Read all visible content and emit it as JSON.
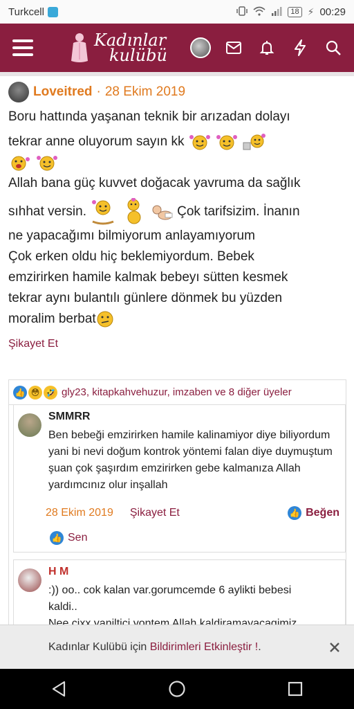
{
  "status_bar": {
    "carrier": "Turkcell",
    "battery": "18",
    "time": "00:29"
  },
  "header": {
    "logo_line1": "Kadınlar",
    "logo_line2": "kulübü",
    "brand_color": "#8a1e3f",
    "icons": [
      "avatar",
      "mail-icon",
      "bell-icon",
      "bolt-icon",
      "search-icon"
    ]
  },
  "post": {
    "author": "Loveitred",
    "separator": "·",
    "date": "28 Ekim 2019",
    "line1": "Boru hattında yaşanan teknik bir arızadan dolayı",
    "line2": "tekrar anne oluyorum sayın kk",
    "line3": "Allah bana güç kuvvet doğacak yavruma da sağlık",
    "line4a": "sıhhat versin.",
    "line4b": "Çok tarifsizim. İnanın",
    "line5": "ne yapacağımı bilmiyorum anlayamıyorum",
    "line6": "Çok erken oldu hiç beklemiyordum. Bebek",
    "line7": "emzirirken hamile kalmak bebeyı sütten kesmek",
    "line8": "tekrar aynı bulantılı günlere dönmek bu yüzden",
    "line9": "moralim berbat",
    "report": "Şikayet Et"
  },
  "reactions": {
    "text": "gly23, kitapkahvehuzur, imzaben ve 8 diğer üyeler"
  },
  "comments": [
    {
      "name": "SMMRR",
      "text": "Ben bebeği emzirirken hamile kalinamiyor diye biliyordum yani bi nevi doğum kontrok yöntemi falan diye duymuştum şuan çok şaşırdım emzirirken gebe kalmanıza Allah yardımcınız olur inşallah",
      "date": "28 Ekim 2019",
      "report": "Şikayet Et",
      "like": "Beğen",
      "reactor": "Sen"
    },
    {
      "name": "H M",
      "text_line1": ":)) oo.. cok kalan var.gorumcemde 6 aylikti bebesi",
      "text_line2": "kaldi..",
      "text_line3": "Nee cixx yaniltici yontem Allah kaldiramayacagimiz"
    }
  ],
  "notification": {
    "prefix": "Kadınlar Kulübü için",
    "link": "Bildirimleri Etkinleştir !",
    "suffix": "."
  }
}
